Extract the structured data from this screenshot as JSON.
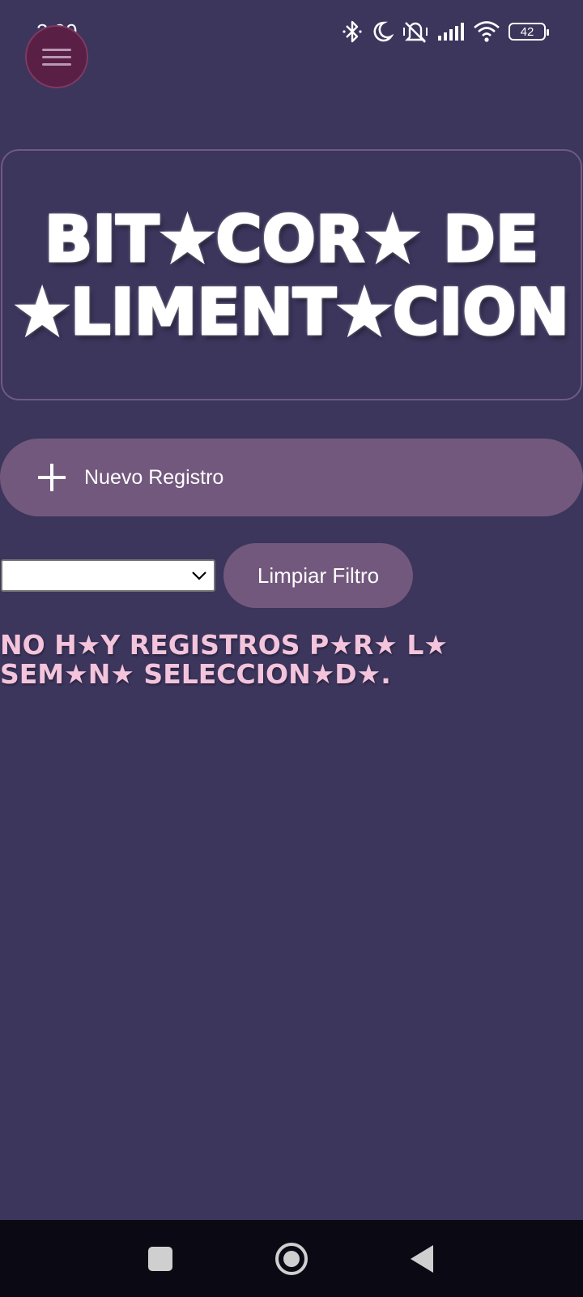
{
  "status_bar": {
    "time": "3:09",
    "battery_level": "42",
    "icons": [
      "bluetooth-icon",
      "do-not-disturb-moon-icon",
      "vibrate-off-icon",
      "signal-icon",
      "wifi-icon",
      "battery-icon"
    ]
  },
  "menu": {
    "icon": "hamburger-menu-icon"
  },
  "header": {
    "title_line1": "BIT★COR★ DE",
    "title_line2": "★LIMENT★CION"
  },
  "actions": {
    "new_record_label": "Nuevo Registro",
    "new_record_icon": "plus-icon",
    "clear_filter_label": "Limpiar Filtro"
  },
  "filter": {
    "selected_value": ""
  },
  "main": {
    "empty_message": "NO H★Y REGISTROS P★R★ L★ SEM★N★ SELECCION★D★."
  },
  "nav_bar": {
    "icons": [
      "recents-square-icon",
      "home-circle-icon",
      "back-triangle-icon"
    ]
  },
  "colors": {
    "background": "#3c355c",
    "button_fill": "#73587d",
    "menu_button": "#5a1f45",
    "message_pink": "#f3c4dc",
    "nav_bar": "#0b0a14"
  }
}
